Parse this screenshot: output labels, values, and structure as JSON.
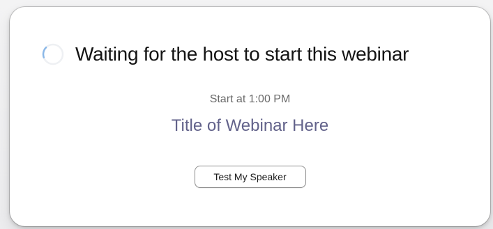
{
  "dialog": {
    "status_title": "Waiting for the host to start this webinar",
    "start_time": "Start at 1:00 PM",
    "webinar_title": "Title of Webinar Here",
    "test_speaker_label": "Test My Speaker"
  },
  "icons": {
    "loading": "spinner-icon"
  },
  "colors": {
    "title_text": "#141414",
    "start_time_text": "#6a6a6a",
    "webinar_title_text": "#62628a",
    "spinner_accent": "#8bb8e8"
  }
}
